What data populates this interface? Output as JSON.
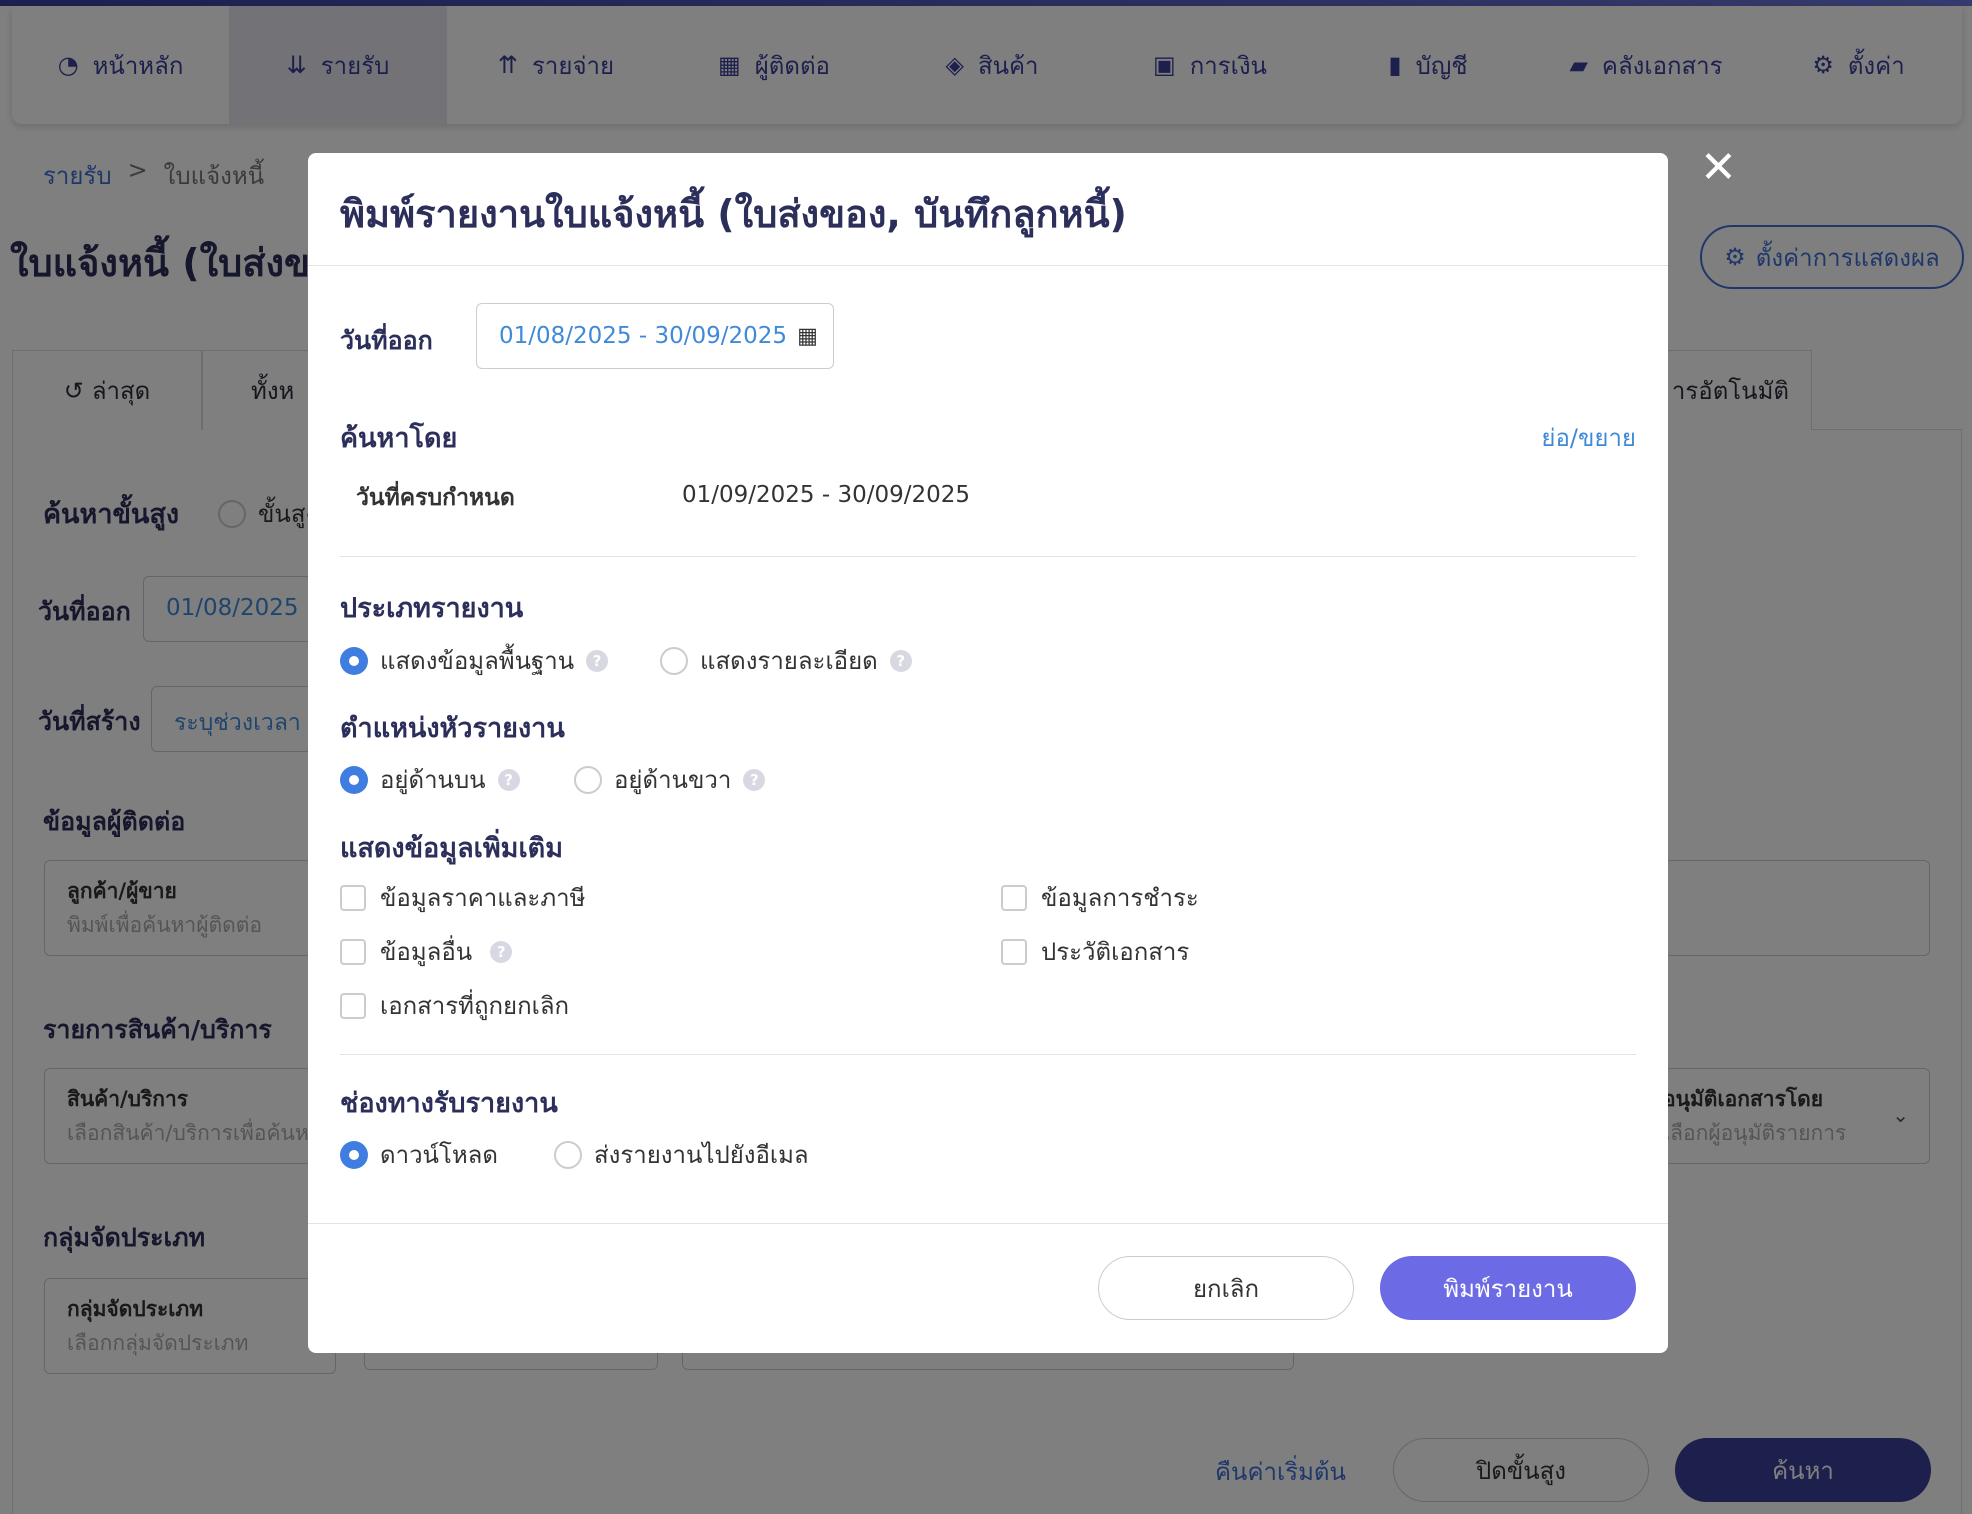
{
  "nav": {
    "items": [
      {
        "label": "หน้าหลัก",
        "icon": "gauge-icon"
      },
      {
        "label": "รายรับ",
        "icon": "sort-down-icon",
        "active": true
      },
      {
        "label": "รายจ่าย",
        "icon": "sort-up-icon"
      },
      {
        "label": "ผู้ติดต่อ",
        "icon": "building-icon"
      },
      {
        "label": "สินค้า",
        "icon": "box-icon"
      },
      {
        "label": "การเงิน",
        "icon": "money-icon"
      },
      {
        "label": "บัญชี",
        "icon": "book-icon"
      },
      {
        "label": "คลังเอกสาร",
        "icon": "folder-icon"
      },
      {
        "label": "ตั้งค่า",
        "icon": "gear-icon"
      }
    ]
  },
  "breadcrumb": {
    "root": "รายรับ",
    "sep": ">",
    "current": "ใบแจ้งหนี้"
  },
  "page": {
    "title": "ใบแจ้งหนี้ (ใบส่งขอ",
    "display_settings": "ตั้งค่าการแสดงผล"
  },
  "tabs": {
    "latest": "ล่าสุด",
    "all": "ทั้งห",
    "auto": "ารอัตโนมัติ"
  },
  "background": {
    "advanced_search": "ค้นหาขั้นสูง",
    "advanced_radio": "ขั้นสูง",
    "issue_date_label": "วันที่ออก",
    "issue_date_value": "01/08/2025",
    "created_date_label": "วันที่สร้าง",
    "created_date_value": "ระบุช่วงเวลา",
    "contact_section": "ข้อมูลผู้ติดต่อ",
    "contact_caption": "ลูกค้า/ผู้ขาย",
    "contact_placeholder": "พิมพ์เพื่อค้นหาผู้ติดต่อ",
    "products_section": "รายการสินค้า/บริการ",
    "products_caption": "สินค้า/บริการ",
    "products_placeholder": "เลือกสินค้า/บริการเพื่อค้นห",
    "approver_caption": "อนุมัติเอกสารโดย",
    "approver_placeholder": "เลือกผู้อนุมัติรายการ",
    "group_section": "กลุ่มจัดประเภท",
    "group_caption": "กลุ่มจัดประเภท",
    "group_placeholder": "เลือกกลุ่มจัดประเภท",
    "reset": "คืนค่าเริ่มต้น",
    "close_advanced": "ปิดขั้นสูง",
    "search": "ค้นหา"
  },
  "modal": {
    "title": "พิมพ์รายงานใบแจ้งหนี้ (ใบส่งของ, บันทึกลูกหนี้)",
    "issue_date_label": "วันที่ออก",
    "issue_date_range": "01/08/2025 - 30/09/2025",
    "search_by": "ค้นหาโดย",
    "toggle": "ย่อ/ขยาย",
    "due_date_label": "วันที่ครบกำหนด",
    "due_date_range": "01/09/2025 - 30/09/2025",
    "report_type": {
      "title": "ประเภทรายงาน",
      "options": [
        "แสดงข้อมูลพื้นฐาน",
        "แสดงรายละเอียด"
      ],
      "selected": "แสดงข้อมูลพื้นฐาน"
    },
    "header_position": {
      "title": "ตำแหน่งหัวรายงาน",
      "options": [
        "อยู่ด้านบน",
        "อยู่ด้านขวา"
      ],
      "selected": "อยู่ด้านบน"
    },
    "extra": {
      "title": "แสดงข้อมูลเพิ่มเติม",
      "price_tax": "ข้อมูลราคาและภาษี",
      "payment": "ข้อมูลการชำระ",
      "other": "ข้อมูลอื่น",
      "history": "ประวัติเอกสาร",
      "cancelled": "เอกสารที่ถูกยกเลิก"
    },
    "delivery": {
      "title": "ช่องทางรับรายงาน",
      "options": [
        "ดาวน์โหลด",
        "ส่งรายงานไปยังอีเมล"
      ],
      "selected": "ดาวน์โหลด"
    },
    "cancel": "ยกเลิก",
    "print": "พิมพ์รายงาน",
    "help_glyph": "?"
  },
  "colors": {
    "primary": "#3f6fd4",
    "print_button": "#6c6ae4",
    "radio_on": "#3f7ee0"
  }
}
